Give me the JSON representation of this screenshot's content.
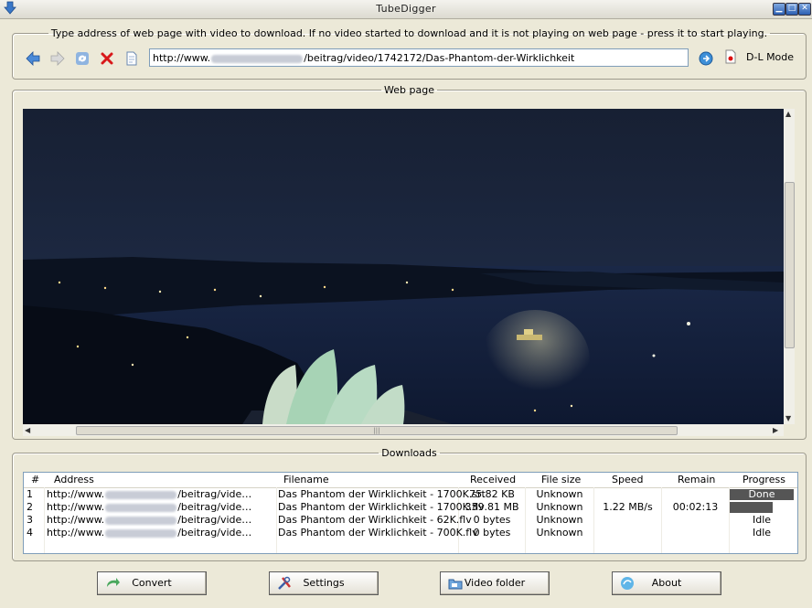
{
  "window": {
    "title": "TubeDigger"
  },
  "address_bar": {
    "legend": "Type address of web page with video to download. If no video started to download and it is not playing on web page - press it to start playing.",
    "url_prefix": "http://www.",
    "url_suffix": "/beitrag/video/1742172/Das-Phantom-der-Wirklichkeit",
    "dl_mode_label": "D-L Mode"
  },
  "webpage": {
    "legend": "Web page"
  },
  "downloads": {
    "legend": "Downloads",
    "columns": [
      "#",
      "Address",
      "Filename",
      "Received",
      "File size",
      "Speed",
      "Remain",
      "Progress"
    ],
    "rows": [
      {
        "num": "1",
        "address_prefix": "http://www.",
        "address_suffix": "/beitrag/vide…",
        "filename": "Das Phantom der Wirklichkeit - 1700K.srt",
        "received": "75.82 KB",
        "filesize": "Unknown",
        "speed": "",
        "remain": "",
        "progress": "Done",
        "progress_fraction": 1.0
      },
      {
        "num": "2",
        "address_prefix": "http://www.",
        "address_suffix": "/beitrag/vide…",
        "filename": "Das Phantom der Wirklichkeit - 1700K.flv",
        "received": "339.81 MB",
        "filesize": "Unknown",
        "speed": "1.22 MB/s",
        "remain": "00:02:13",
        "progress": "67.70%",
        "progress_fraction": 0.677
      },
      {
        "num": "3",
        "address_prefix": "http://www.",
        "address_suffix": "/beitrag/vide…",
        "filename": "Das Phantom der Wirklichkeit - 62K.flv",
        "received": "0 bytes",
        "filesize": "Unknown",
        "speed": "",
        "remain": "",
        "progress": "Idle",
        "progress_fraction": 0
      },
      {
        "num": "4",
        "address_prefix": "http://www.",
        "address_suffix": "/beitrag/vide…",
        "filename": "Das Phantom der Wirklichkeit - 700K.flv",
        "received": "0 bytes",
        "filesize": "Unknown",
        "speed": "",
        "remain": "",
        "progress": "Idle",
        "progress_fraction": 0
      }
    ]
  },
  "buttons": {
    "convert": "Convert",
    "settings": "Settings",
    "video_folder": "Video folder",
    "about": "About"
  },
  "colors": {
    "progress_fill": "#555555",
    "accent": "#2c5fb2"
  },
  "icons": [
    "app-download-icon",
    "back-arrow-icon",
    "forward-arrow-icon",
    "refresh-icon",
    "stop-icon",
    "page-icon",
    "go-icon",
    "record-icon",
    "convert-icon",
    "settings-icon",
    "folder-icon",
    "about-icon"
  ]
}
